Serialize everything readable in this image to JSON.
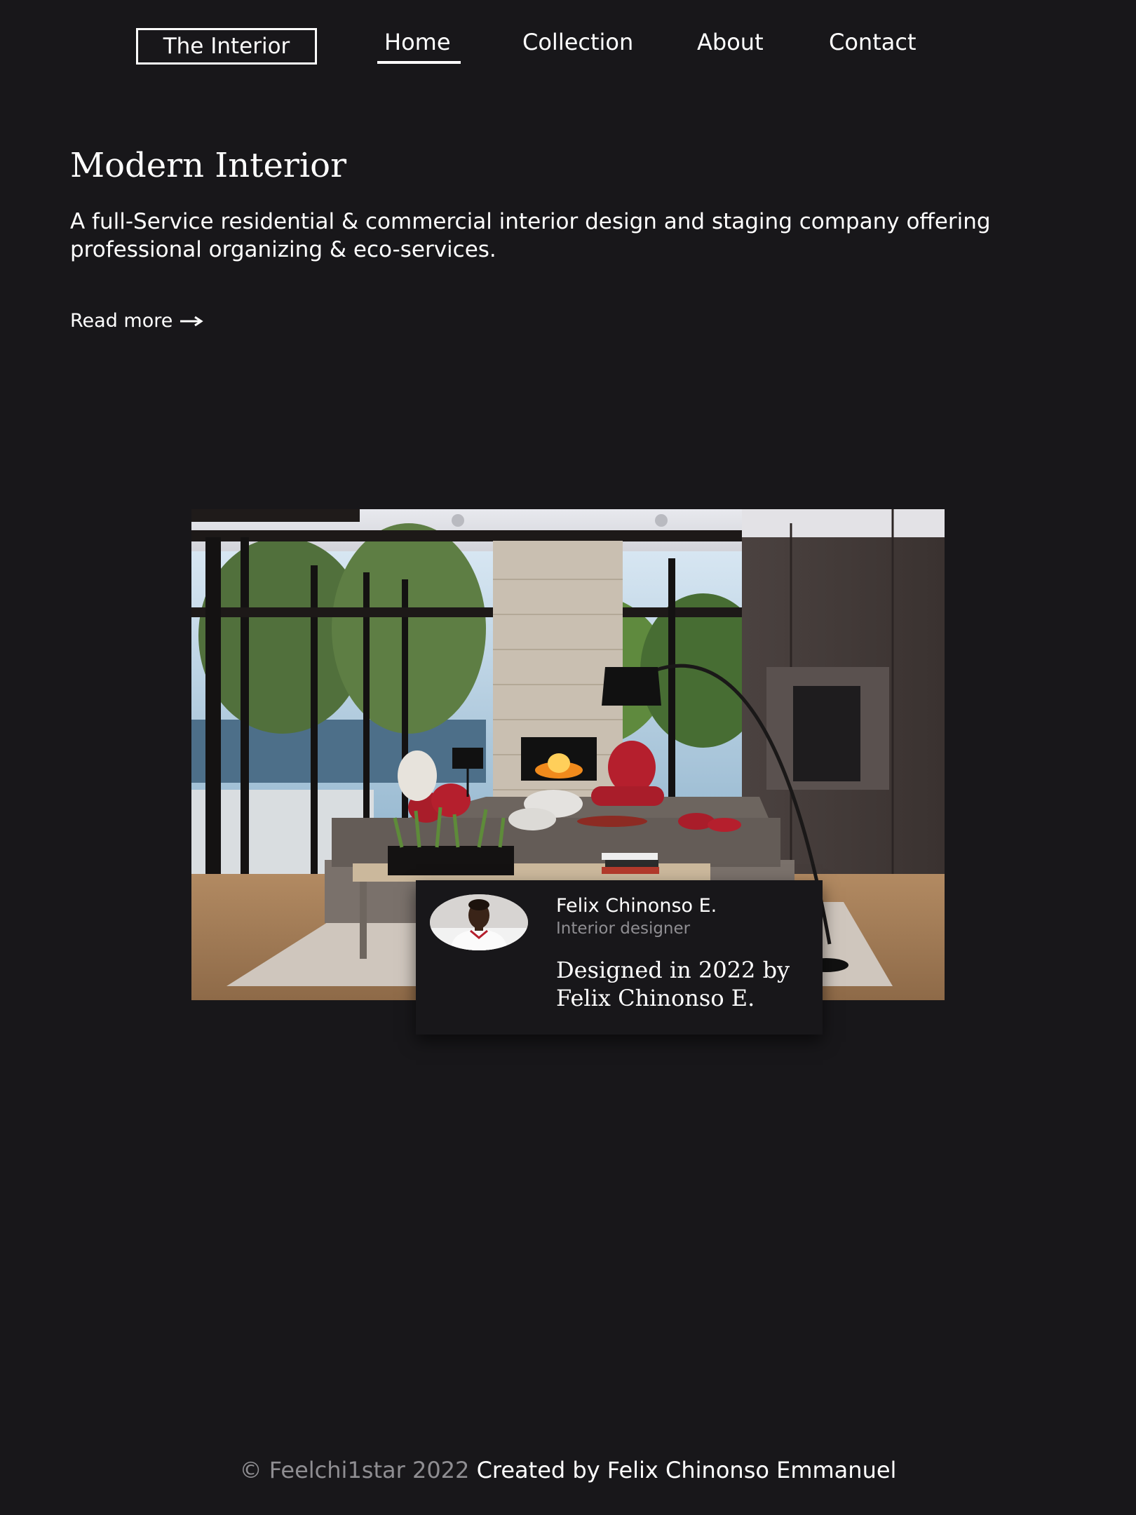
{
  "nav": {
    "brand": "The Interior",
    "links": [
      {
        "label": "Home",
        "active": true
      },
      {
        "label": "Collection",
        "active": false
      },
      {
        "label": "About",
        "active": false
      },
      {
        "label": "Contact",
        "active": false
      }
    ]
  },
  "hero": {
    "title": "Modern Interior",
    "description": "A full-Service residential & commercial interior design and staging company offering professional organizing & eco-services.",
    "read_more": "Read more",
    "read_more_icon": "arrow-right-icon"
  },
  "showcase": {
    "image": "modern-living-room-photo"
  },
  "designer": {
    "avatar": "designer-portrait",
    "name": "Felix Chinonso E.",
    "role": "Interior designer",
    "credit": "Designed in 2022 by Felix Chinonso E."
  },
  "footer": {
    "copyright": "© Feelchi1star 2022",
    "credit": "Created by Felix Chinonso Emmanuel"
  },
  "colors": {
    "background": "#18171a",
    "text": "#ffffff",
    "muted": "#8f8e92",
    "accent_red": "#b51f2d"
  }
}
